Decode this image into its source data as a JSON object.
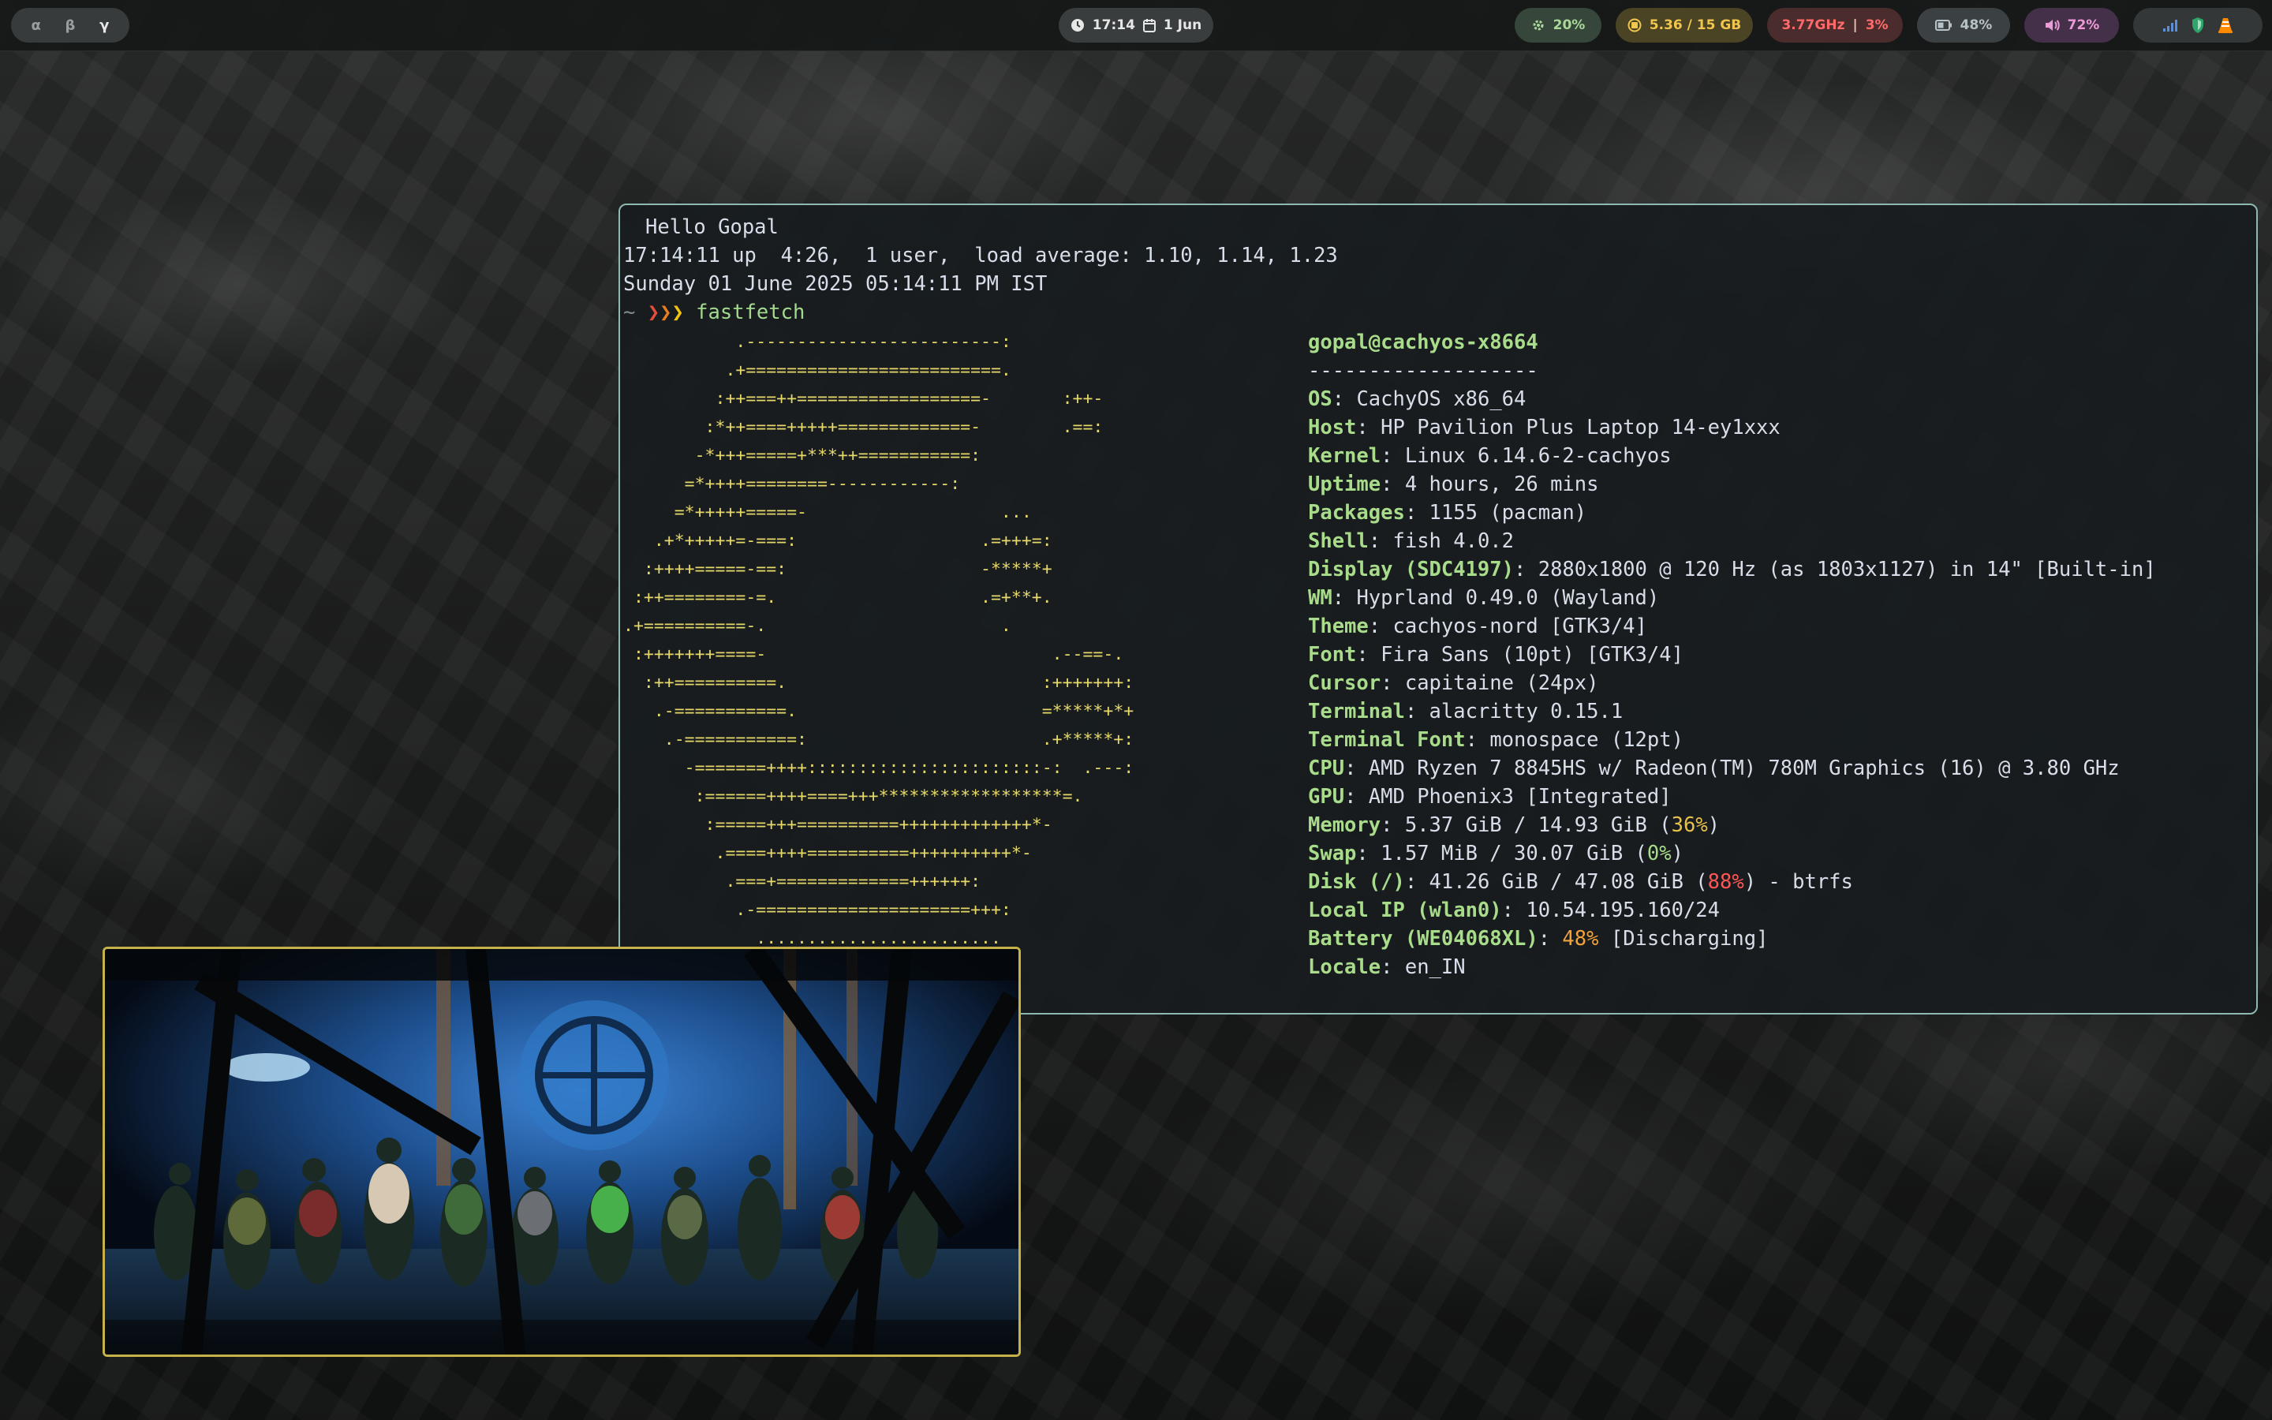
{
  "topbar": {
    "workspaces": [
      "α",
      "β",
      "γ"
    ],
    "active_workspace": "γ",
    "clock": {
      "time": "17:14",
      "date": "1 Jun"
    },
    "cpu_temp": "20%",
    "memory": "5.36 / 15 GB",
    "cpu_freq": "3.77GHz",
    "cpu_usage": "3%",
    "battery": "48%",
    "volume": "72%",
    "tray_icons": [
      "signal-bars-icon",
      "shield-icon",
      "vlc-cone-icon"
    ]
  },
  "terminal": {
    "greeting": "Hello Gopal",
    "uptime": "17:14:11 up  4:26,  1 user,  load average: 1.10, 1.14, 1.23",
    "date": "Sunday 01 June 2025 05:14:11 PM IST",
    "prompt_symbol": "~",
    "command": "fastfetch",
    "logo": "           .-------------------------:\n          .+=========================.\n         :++===++==================-       :++-\n        :*++====+++++=============-        .==:\n       -*+++=====+***++===========:\n      =*++++========------------:\n     =*+++++=====-                   ...\n   .+*+++++=-===:                  .=+++=:\n  :++++=====-==:                   -*****+\n :++========-=.                    .=+**+.\n.+==========-.                       .\n :+++++++====-                            .--==-.\n  :++==========.                         :+++++++:\n   .-===========.                        =*****+*+\n    .-===========:                       .+*****+:\n      -=======++++:::::::::::::::::::::::-:  .---:\n       :======++++====+++******************=.\n        :=====+++==========+++++++++++++*-\n         .====++++==========++++++++++*-\n          .===+=============++++++:\n           .-=====================+++:\n             ........................",
    "fastfetch": {
      "user_host": "gopal@cachyos-x8664",
      "separator": "-------------------",
      "rows": [
        {
          "key": "OS",
          "value": "CachyOS x86_64"
        },
        {
          "key": "Host",
          "value": "HP Pavilion Plus Laptop 14-ey1xxx"
        },
        {
          "key": "Kernel",
          "value": "Linux 6.14.6-2-cachyos"
        },
        {
          "key": "Uptime",
          "value": "4 hours, 26 mins"
        },
        {
          "key": "Packages",
          "value": "1155 (pacman)"
        },
        {
          "key": "Shell",
          "value": "fish 4.0.2"
        },
        {
          "key": "Display (SDC4197)",
          "value": "2880x1800 @ 120 Hz (as 1803x1127) in 14\" [Built-in]"
        },
        {
          "key": "WM",
          "value": "Hyprland 0.49.0 (Wayland)"
        },
        {
          "key": "Theme",
          "value": "cachyos-nord [GTK3/4]"
        },
        {
          "key": "Font",
          "value": "Fira Sans (10pt) [GTK3/4]"
        },
        {
          "key": "Cursor",
          "value": "capitaine (24px)"
        },
        {
          "key": "Terminal",
          "value": "alacritty 0.15.1"
        },
        {
          "key": "Terminal Font",
          "value": "monospace (12pt)"
        },
        {
          "key": "CPU",
          "value": "AMD Ryzen 7 8845HS w/ Radeon(TM) 780M Graphics (16) @ 3.80 GHz"
        },
        {
          "key": "GPU",
          "value": "AMD Phoenix3 [Integrated]"
        },
        {
          "key": "Memory",
          "value": "5.37 GiB / 14.93 GiB (",
          "pct": "36%",
          "after": ")",
          "pct_color": "#e6c14b"
        },
        {
          "key": "Swap",
          "value": "1.57 MiB / 30.07 GiB (",
          "pct": "0%",
          "after": ")",
          "pct_color": "#a9dc8a"
        },
        {
          "key": "Disk (/)",
          "value": "41.26 GiB / 47.08 GiB (",
          "pct": "88%",
          "after": ") - btrfs",
          "pct_color": "#ff5555"
        },
        {
          "key": "Local IP (wlan0)",
          "value": "10.54.195.160/24"
        },
        {
          "key": "Battery (WE04068XL)",
          "value": "",
          "pct": "48%",
          "after": " [Discharging]",
          "pct_color": "#f2a23b"
        },
        {
          "key": "Locale",
          "value": "en_IN"
        }
      ]
    }
  },
  "colors": {
    "terminal_border": "#8fb9b0",
    "logo": "#e6d96a",
    "key": "#a9dc8a",
    "video_border": "#c7b24a"
  }
}
